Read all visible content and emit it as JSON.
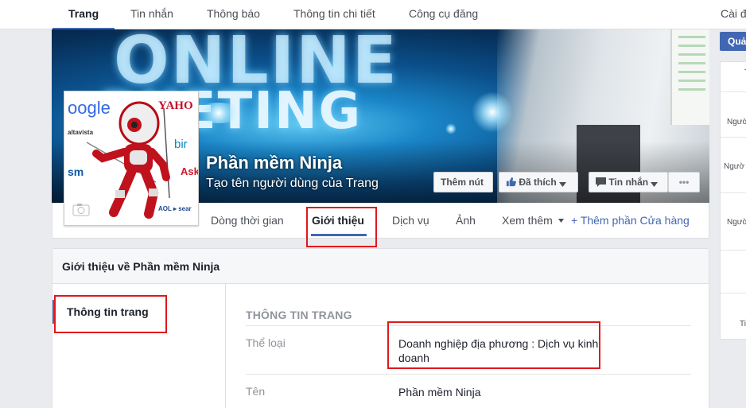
{
  "topnav": {
    "tabs": [
      "Trang",
      "Tin nhắn",
      "Thông báo",
      "Thông tin chi tiết",
      "Công cụ đăng"
    ],
    "settings": "Cài đ"
  },
  "cover": {
    "headline_1": "ONLINE",
    "headline_2": "RKETING"
  },
  "page": {
    "name": "Phần mềm Ninja",
    "username_prompt": "Tạo tên người dùng của Trang"
  },
  "profile_logos": {
    "google": "oogle",
    "yahoo": "YAHO",
    "altavista": "altavista",
    "bing": "bir",
    "msn": "sm",
    "ask": "Ask",
    "aol": "AOL ▸ sear"
  },
  "cover_buttons": {
    "add_button": "Thêm nút",
    "liked": "Đã thích",
    "message": "Tin nhắn",
    "more": "•••"
  },
  "page_tabs": {
    "items": [
      "Dòng thời gian",
      "Giới thiệu",
      "Dịch vụ",
      "Ảnh",
      "Xem thêm"
    ],
    "add_shop": "+ Thêm phần Cửa hàng"
  },
  "about": {
    "header": "Giới thiệu về Phần mềm Ninja",
    "side_item": "Thông tin trang",
    "section_title": "THÔNG TIN TRANG",
    "rows": [
      {
        "label": "Thể loại",
        "value_line1": "Doanh nghiệp địa phương : Dịch vụ kinh",
        "value_line2": "doanh"
      },
      {
        "label": "Tên",
        "value_line1": "Phần mềm Ninja"
      }
    ]
  },
  "right_column": {
    "button": "Quả",
    "top_char": "T",
    "items": [
      "Ngườ",
      "Ngườ",
      "Ngườ",
      "Ti"
    ]
  },
  "colors": {
    "accent": "#4267b2",
    "annotation_red": "#e0181c"
  }
}
